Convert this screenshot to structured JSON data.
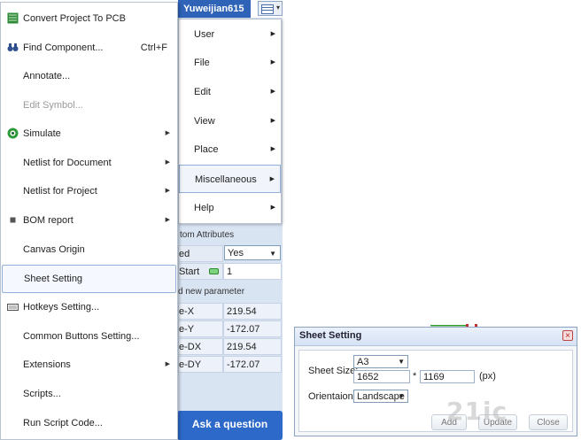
{
  "header": {
    "username": "Yuweijian615",
    "caret": "▾"
  },
  "main_menu": {
    "items": [
      {
        "label": "Convert Project To PCB",
        "icon": "pcb-convert-icon",
        "submenu": false,
        "disabled": false
      },
      {
        "label": "Find Component...",
        "shortcut": "Ctrl+F",
        "icon": "binoculars-icon",
        "submenu": false,
        "disabled": false
      },
      {
        "label": "Annotate...",
        "submenu": false,
        "disabled": false
      },
      {
        "label": "Edit Symbol...",
        "submenu": false,
        "disabled": true
      },
      {
        "label": "Simulate",
        "icon": "simulate-icon",
        "submenu": true,
        "disabled": false
      },
      {
        "label": "Netlist for Document",
        "submenu": true,
        "disabled": false
      },
      {
        "label": "Netlist for Project",
        "submenu": true,
        "disabled": false
      },
      {
        "label": "BOM report",
        "icon": "bom-icon",
        "submenu": true,
        "disabled": false
      },
      {
        "label": "Canvas Origin",
        "submenu": false,
        "disabled": false
      },
      {
        "label": "Sheet Setting",
        "submenu": false,
        "disabled": false,
        "highlighted": true
      },
      {
        "label": "Hotkeys Setting...",
        "icon": "keyboard-icon",
        "submenu": false,
        "disabled": false
      },
      {
        "label": "Common Buttons Setting...",
        "submenu": false,
        "disabled": false
      },
      {
        "label": "Extensions",
        "submenu": true,
        "disabled": false
      },
      {
        "label": "Scripts...",
        "submenu": false,
        "disabled": false
      },
      {
        "label": "Run Script Code...",
        "submenu": false,
        "disabled": false
      }
    ],
    "arrow": "▶"
  },
  "sub_menu": {
    "items": [
      {
        "label": "User"
      },
      {
        "label": "File"
      },
      {
        "label": "Edit"
      },
      {
        "label": "View"
      },
      {
        "label": "Place"
      },
      {
        "label": "Miscellaneous",
        "highlighted": true
      },
      {
        "label": "Help"
      }
    ]
  },
  "properties": {
    "header": "tom Attributes",
    "rows": [
      {
        "key": "ed",
        "value": "Yes",
        "type": "select"
      },
      {
        "key": "Start",
        "value": "1",
        "type": "input"
      }
    ],
    "add_param": "d new parameter",
    "coords": [
      {
        "key": "e-X",
        "value": "219.54"
      },
      {
        "key": "e-Y",
        "value": "-172.07"
      },
      {
        "key": "e-DX",
        "value": "219.54"
      },
      {
        "key": "e-DY",
        "value": "-172.07"
      }
    ]
  },
  "ask_button": "Ask a question",
  "dialog": {
    "title": "Sheet Setting",
    "close": "×",
    "sheet_size_label": "Sheet Size:",
    "sheet_size_value": "A3",
    "width": "1652",
    "times": "*",
    "height": "1169",
    "unit": "(px)",
    "orientation_label": "Orientaion:",
    "orientation_value": "Landscape",
    "buttons": [
      "Add",
      "Update",
      "Close"
    ]
  },
  "watermark": "21ic.com"
}
